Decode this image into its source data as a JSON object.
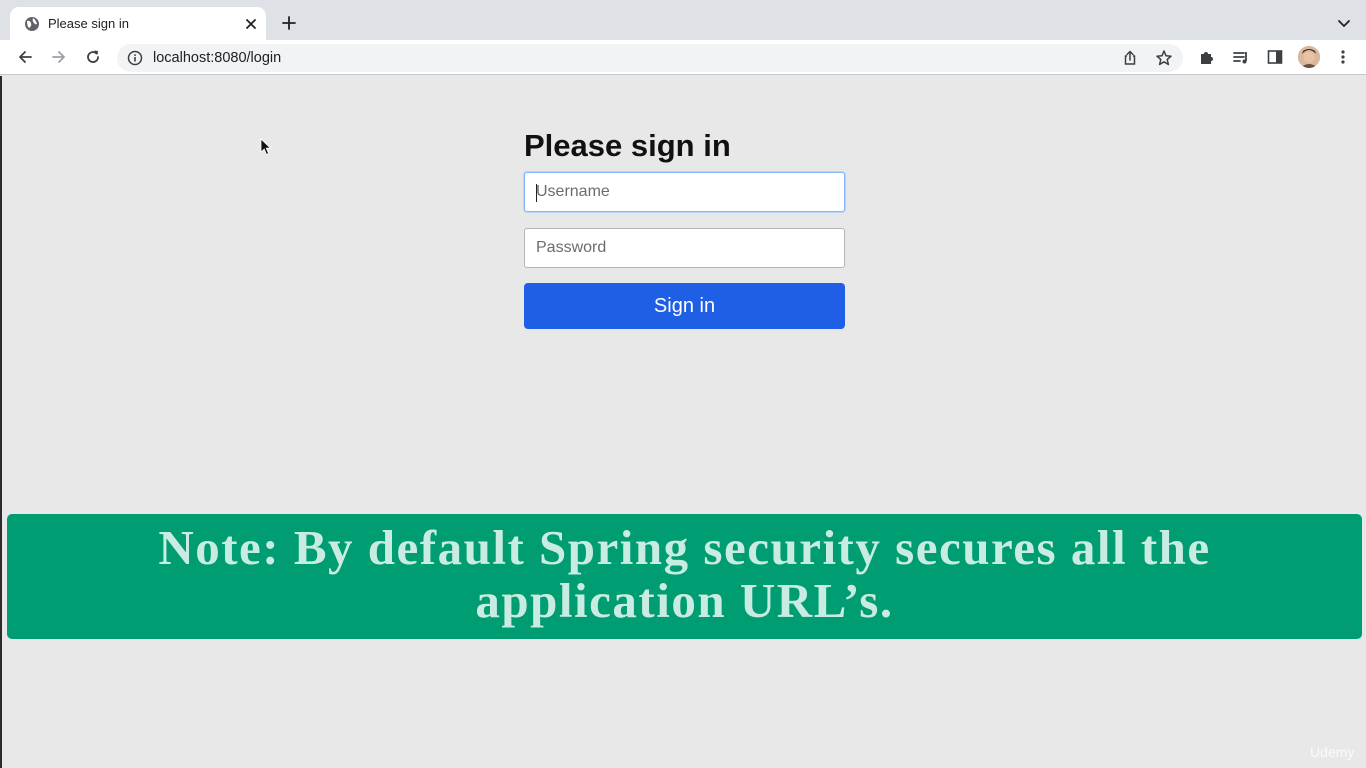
{
  "browser": {
    "tab_title": "Please sign in",
    "url": "localhost:8080/login"
  },
  "login": {
    "heading": "Please sign in",
    "username_placeholder": "Username",
    "password_placeholder": "Password",
    "submit_label": "Sign in"
  },
  "overlay": {
    "note": "Note: By default Spring security secures all the application URL’s."
  },
  "watermark": "Udemy",
  "colors": {
    "page_background": "#e8e8e8",
    "button": "#1f5fe6",
    "banner": "#009d72",
    "banner_text": "#c9ece2"
  }
}
